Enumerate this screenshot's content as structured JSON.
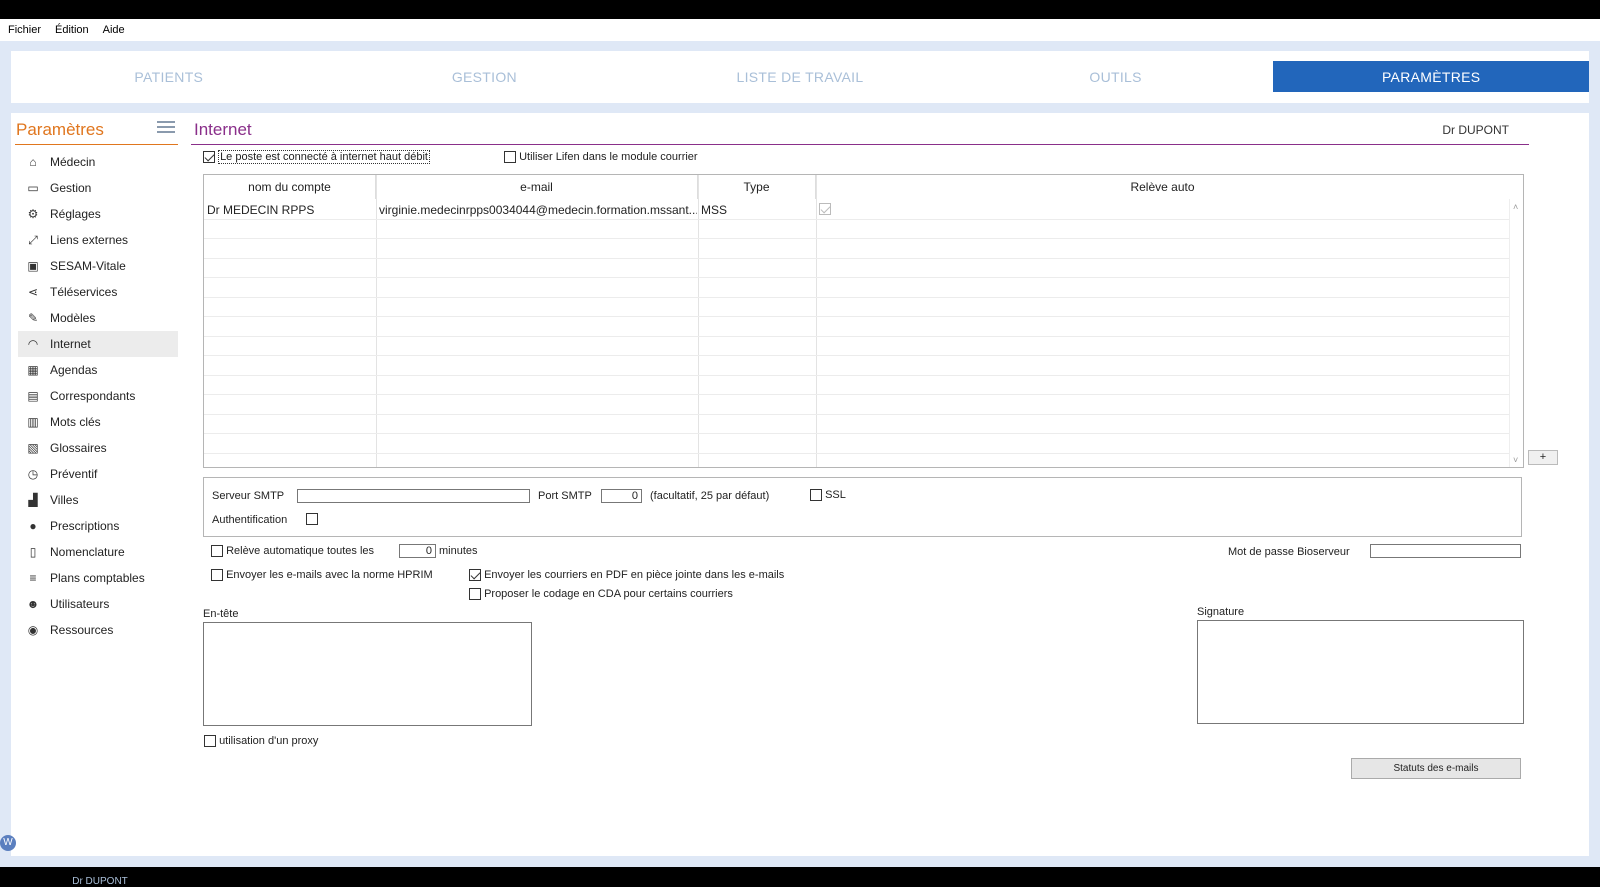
{
  "menu": [
    "Fichier",
    "Édition",
    "Aide"
  ],
  "nav": {
    "tabs": [
      {
        "label": "PATIENTS",
        "active": false
      },
      {
        "label": "GESTION",
        "active": false
      },
      {
        "label": "LISTE DE TRAVAIL",
        "active": false
      },
      {
        "label": "OUTILS",
        "active": false
      },
      {
        "label": "PARAMÈTRES",
        "active": true
      }
    ]
  },
  "sidebar": {
    "title": "Paramètres",
    "footer": "Dr DUPONT",
    "selected": "Internet",
    "items": [
      {
        "label": "Médecin",
        "icon": "home-icon",
        "glyph": "⌂"
      },
      {
        "label": "Gestion",
        "icon": "inbox-icon",
        "glyph": "▭"
      },
      {
        "label": "Réglages",
        "icon": "gears-icon",
        "glyph": "⚙"
      },
      {
        "label": "Liens externes",
        "icon": "expand-icon",
        "glyph": "⤢"
      },
      {
        "label": "SESAM-Vitale",
        "icon": "card-reader-icon",
        "glyph": "▣"
      },
      {
        "label": "Téléservices",
        "icon": "share-icon",
        "glyph": "⋖"
      },
      {
        "label": "Modèles",
        "icon": "edit-icon",
        "glyph": "✎"
      },
      {
        "label": "Internet",
        "icon": "wifi-icon",
        "glyph": "◠"
      },
      {
        "label": "Agendas",
        "icon": "calendar-icon",
        "glyph": "▦"
      },
      {
        "label": "Correspondants",
        "icon": "contact-card-icon",
        "glyph": "▤"
      },
      {
        "label": "Mots clés",
        "icon": "bar-chart-icon",
        "glyph": "▥"
      },
      {
        "label": "Glossaires",
        "icon": "clipboard-icon",
        "glyph": "▧"
      },
      {
        "label": "Préventif",
        "icon": "clock-icon",
        "glyph": "◷"
      },
      {
        "label": "Villes",
        "icon": "city-icon",
        "glyph": "▟"
      },
      {
        "label": "Prescriptions",
        "icon": "pills-icon",
        "glyph": "●"
      },
      {
        "label": "Nomenclature",
        "icon": "document-icon",
        "glyph": "▯"
      },
      {
        "label": "Plans comptables",
        "icon": "list-icon",
        "glyph": "≡"
      },
      {
        "label": "Utilisateurs",
        "icon": "users-icon",
        "glyph": "☻"
      },
      {
        "label": "Ressources",
        "icon": "car-icon",
        "glyph": "◉"
      }
    ]
  },
  "main": {
    "title": "Internet",
    "user": "Dr DUPONT",
    "highspeed_label": "Le poste est connecté à internet haut débit",
    "highspeed_checked": true,
    "lifen_label": "Utiliser Lifen dans le module courrier",
    "lifen_checked": false,
    "table": {
      "headers": [
        "nom du compte",
        "e-mail",
        "Type",
        "Relève auto"
      ],
      "rows": [
        {
          "account": "Dr MEDECIN RPPS",
          "email": "virginie.medecinrpps0034044@medecin.formation.mssant...",
          "type": "MSS",
          "auto": true
        }
      ],
      "add_label": "+"
    },
    "smtp": {
      "server_label": "Serveur SMTP",
      "server_value": "",
      "port_label": "Port SMTP",
      "port_value": "0",
      "port_hint": "(facultatif, 25 par défaut)",
      "ssl_label": "SSL",
      "auth_label": "Authentification"
    },
    "auto_fetch_label": "Relève automatique toutes les",
    "auto_fetch_value": "0",
    "minutes_label": "minutes",
    "bioserveur_label": "Mot de passe Bioserveur",
    "bioserveur_value": "",
    "hprim_label": "Envoyer les e-mails avec la norme HPRIM",
    "pdf_label": "Envoyer les courriers en PDF en pièce jointe dans les e-mails",
    "pdf_checked": true,
    "cda_label": "Proposer le codage en CDA pour certains courriers",
    "header_label": "En-tête",
    "signature_label": "Signature",
    "proxy_label": "utilisation d'un proxy",
    "status_button": "Statuts des e-mails"
  },
  "colors": {
    "accent_blue": "#2266bb",
    "sidebar_title": "#e0761e",
    "main_title": "#8a2f8a",
    "background": "#dfe8f6"
  }
}
